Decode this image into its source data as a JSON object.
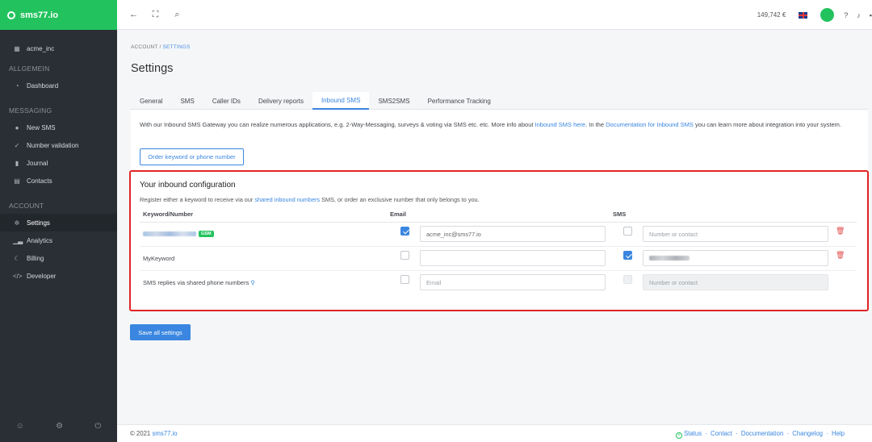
{
  "app": {
    "brand": "sms77.io"
  },
  "sidebar": {
    "account_name": "acme_inc",
    "sections": [
      {
        "heading": "ALLGEMEIN",
        "items": [
          {
            "label": "Dashboard",
            "icon": "speedometer-icon"
          }
        ]
      },
      {
        "heading": "MESSAGING",
        "items": [
          {
            "label": "New SMS",
            "icon": "chat-icon"
          },
          {
            "label": "Number validation",
            "icon": "check-icon"
          },
          {
            "label": "Journal",
            "icon": "book-icon"
          },
          {
            "label": "Contacts",
            "icon": "contact-card-icon"
          }
        ]
      },
      {
        "heading": "ACCOUNT",
        "items": [
          {
            "label": "Settings",
            "icon": "gear-icon",
            "active": true
          },
          {
            "label": "Analytics",
            "icon": "chart-icon"
          },
          {
            "label": "Billing",
            "icon": "moon-icon"
          },
          {
            "label": "Developer",
            "icon": "code-icon"
          }
        ]
      }
    ]
  },
  "topbar": {
    "balance": "149,742 €"
  },
  "breadcrumb": {
    "root": "ACCOUNT",
    "separator": "/",
    "current": "SETTINGS"
  },
  "page_title": "Settings",
  "tabs": [
    "General",
    "SMS",
    "Caller IDs",
    "Delivery reports",
    "Inbound SMS",
    "SMS2SMS",
    "Performance Tracking"
  ],
  "active_tab": "Inbound SMS",
  "intro": {
    "text_1": "With our Inbound SMS Gateway you can realize numerous applications, e.g. 2-Way-Messaging, surveys & voting via SMS etc. etc. More info about ",
    "link_1": "Inbound SMS here",
    "text_2": ". In the ",
    "link_2": "Documentation for Inbound SMS",
    "text_3": " you can learn more about integration into your system."
  },
  "order_button": "Order keyword or phone number",
  "config": {
    "title": "Your inbound configuration",
    "subtitle_1": "Register either a keyword to receive via our ",
    "subtitle_link": "shared inbound numbers",
    "subtitle_2": " SMS, or order an exclusive number that only belongs to you.",
    "columns": {
      "keyword": "Keyword/Number",
      "email": "Email",
      "sms": "SMS"
    },
    "rows": [
      {
        "keyword": "",
        "badge": "GSM",
        "email_checked": true,
        "email_value": "acme_inc@sms77.io",
        "sms_checked": false,
        "sms_placeholder": "Number or contact"
      },
      {
        "keyword": "MyKeyword",
        "email_checked": false,
        "email_value": "",
        "sms_checked": true,
        "sms_value": ""
      },
      {
        "keyword": "SMS replies via shared phone numbers",
        "email_checked": false,
        "email_placeholder": "Email",
        "sms_checked": false,
        "sms_placeholder": "Number or contact"
      }
    ]
  },
  "save_button": "Save all settings",
  "footer": {
    "copyright": "© 2021 ",
    "brand_link": "sms77.io",
    "links": [
      "Status",
      "Contact",
      "Documentation",
      "Changelog",
      "Help"
    ],
    "separator": "·"
  },
  "colors": {
    "brand": "#22c35e",
    "accent": "#3a86e0",
    "sidebar": "#2a2f35",
    "highlight": "#e02424"
  }
}
